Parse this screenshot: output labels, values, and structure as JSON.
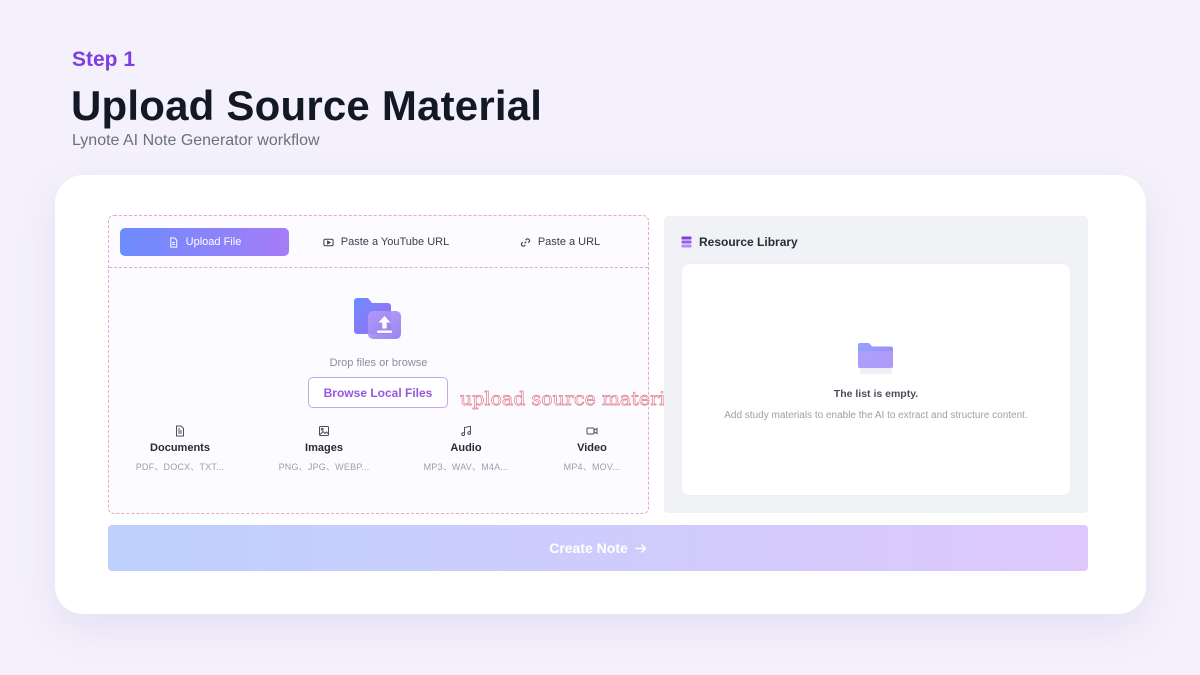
{
  "header": {
    "step": "Step 1",
    "title": "Upload Source Material",
    "subtitle": "Lynote AI Note Generator workflow"
  },
  "tabs": [
    {
      "label": "Upload File",
      "icon": "file-icon",
      "active": true
    },
    {
      "label": "Paste a YouTube URL",
      "icon": "youtube-icon",
      "active": false
    },
    {
      "label": "Paste a URL",
      "icon": "link-icon",
      "active": false
    }
  ],
  "dropzone": {
    "icon": "folder-upload-icon",
    "text": "Drop files or browse",
    "browse_label": "Browse Local Files",
    "annotation": "upload source material"
  },
  "file_types": [
    {
      "name": "Documents",
      "ext": "PDF、DOCX、TXT...",
      "icon": "document-icon"
    },
    {
      "name": "Images",
      "ext": "PNG、JPG、WEBP...",
      "icon": "image-icon"
    },
    {
      "name": "Audio",
      "ext": "MP3、WAV、M4A...",
      "icon": "music-icon"
    },
    {
      "name": "Video",
      "ext": "MP4、MOV...",
      "icon": "video-icon"
    }
  ],
  "library": {
    "title": "Resource Library",
    "icon": "library-stack-icon",
    "empty_title": "The list is empty.",
    "empty_desc": "Add study materials to enable the AI to extract and structure content."
  },
  "create_button": {
    "label": "Create Note",
    "icon": "arrow-right-icon"
  },
  "colors": {
    "accent": "#7e3fe0",
    "tab_gradient_start": "#6c8cff",
    "tab_gradient_end": "#a57cf7",
    "dashed_border": "#e3a9cf"
  }
}
